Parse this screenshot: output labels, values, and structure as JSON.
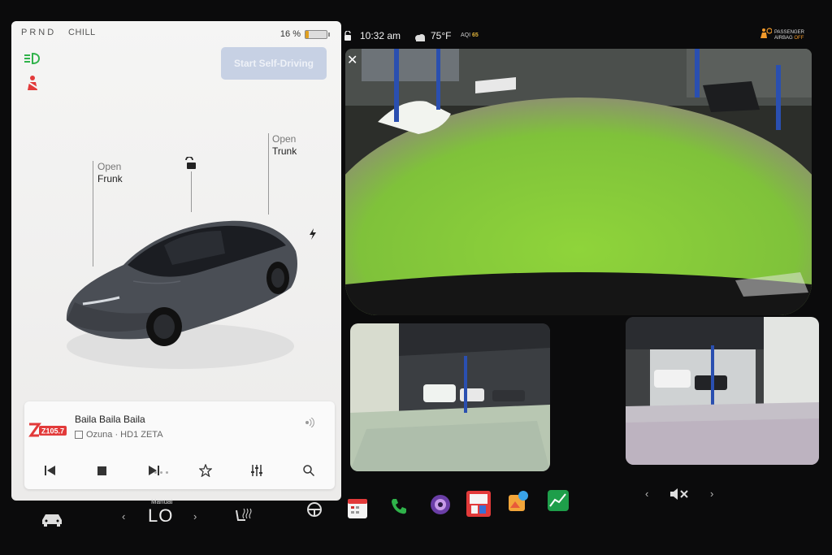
{
  "left_panel": {
    "gear": "PRND",
    "drive_mode": "CHILL",
    "battery_percent": "16 %",
    "battery_level": 0.16,
    "self_driving_button": "Start Self-Driving",
    "frunk": {
      "line1": "Open",
      "line2": "Frunk"
    },
    "trunk": {
      "line1": "Open",
      "line2": "Trunk"
    },
    "icons": [
      "headlights-icon",
      "seatbelt-warning-icon",
      "unlock-icon",
      "charge-port-bolt-icon"
    ]
  },
  "media": {
    "station_logo_text": "Z105.7",
    "song_title": "Baila Baila Baila",
    "artist_line": "Ozuna · HD1 ZETA",
    "controls": [
      "previous-icon",
      "stop-icon",
      "next-icon",
      "favorite-star-icon",
      "equalizer-icon",
      "search-icon"
    ]
  },
  "status_bar": {
    "time": "10:32 am",
    "temperature": "75°F",
    "aqi_label": "AQI",
    "aqi_value": "65",
    "airbag_line1": "PASSENGER",
    "airbag_line2": "AIRBAG",
    "airbag_state": "OFF"
  },
  "dock": {
    "climate_mode": "Manual",
    "climate_temp": "LO",
    "apps": [
      "car-icon",
      "seat-heater-icon",
      "steering-wheel-heater-icon",
      "calendar-icon",
      "phone-icon",
      "camera-icon",
      "toybox-icon",
      "arcade-icon",
      "energy-icon",
      "mute-volume-icon"
    ]
  },
  "colors": {
    "accent_blue": "#c7d1e4",
    "warning_red": "#e23a3a",
    "light_green": "#2fb24a",
    "battery_orange": "#e0a020"
  }
}
